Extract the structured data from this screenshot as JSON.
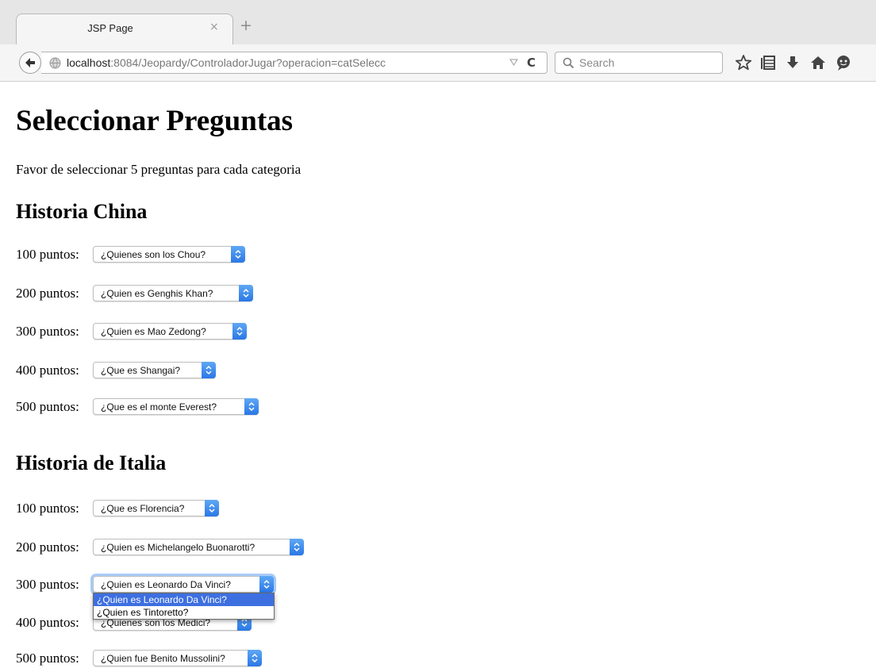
{
  "browser": {
    "tab_title": "JSP Page",
    "tab_close": "×",
    "new_tab": "+",
    "url_host": "localhost",
    "url_rest": ":8084/Jeopardy/ControladorJugar?operacion=catSelecc",
    "reload": "C",
    "search_placeholder": "Search"
  },
  "page": {
    "title": "Seleccionar Preguntas",
    "intro": "Favor de seleccionar 5 preguntas para cada categoria"
  },
  "categories": [
    {
      "name": "Historia China",
      "rows": [
        {
          "points": "100 puntos:",
          "selected": "¿Quienes son los Chou?"
        },
        {
          "points": "200 puntos:",
          "selected": "¿Quien es Genghis Khan?"
        },
        {
          "points": "300 puntos:",
          "selected": "¿Quien es Mao Zedong?"
        },
        {
          "points": "400 puntos:",
          "selected": "¿Que es Shangai?"
        },
        {
          "points": "500 puntos:",
          "selected": "¿Que es el monte Everest?"
        }
      ]
    },
    {
      "name": "Historia de Italia",
      "rows": [
        {
          "points": "100 puntos:",
          "selected": "¿Que es Florencia?"
        },
        {
          "points": "200 puntos:",
          "selected": "¿Quien es Michelangelo Buonarotti?"
        },
        {
          "points": "300 puntos:",
          "selected": "¿Quien es Leonardo Da Vinci?"
        },
        {
          "points": "400 puntos:",
          "selected": "¿Quienes son los Medici?"
        },
        {
          "points": "500 puntos:",
          "selected": "¿Quien fue Benito Mussolini?"
        }
      ]
    }
  ],
  "open_dropdown": {
    "options": [
      "¿Quien es Leonardo Da Vinci?",
      "¿Quien es Tintoretto?"
    ]
  },
  "colors": {
    "select_arrow": "#2a77e6",
    "highlight": "#3d6fe0"
  }
}
